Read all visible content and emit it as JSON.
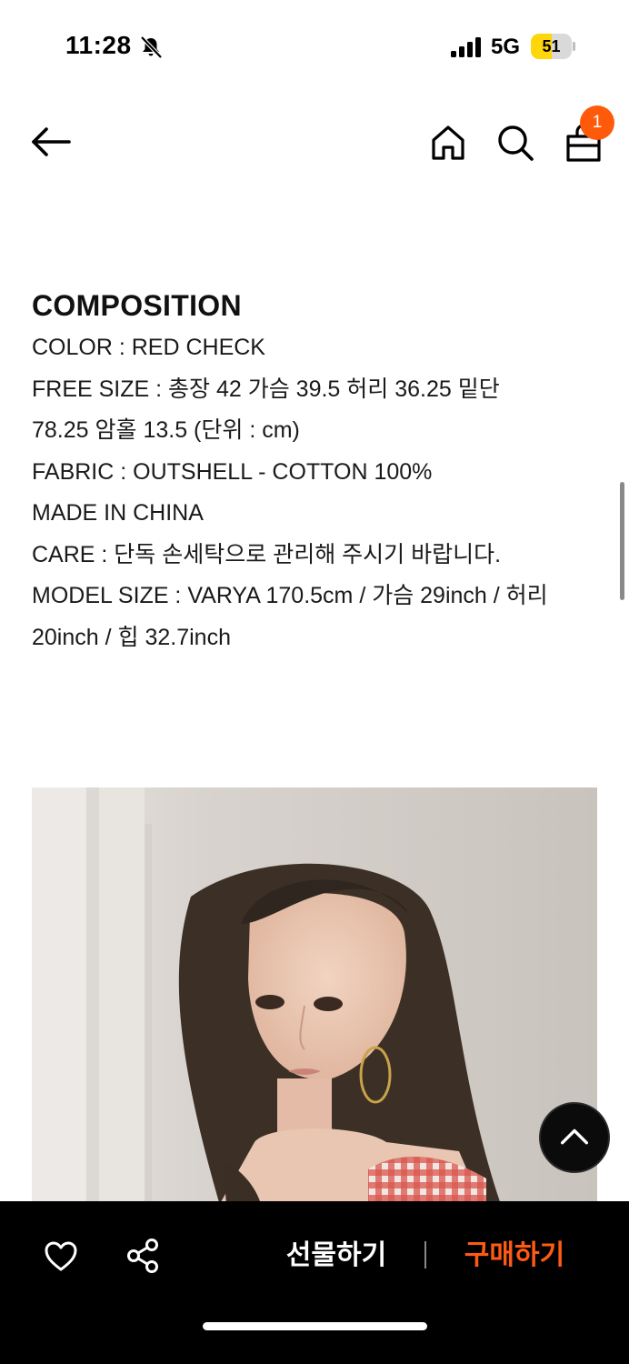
{
  "status_bar": {
    "time": "11:28",
    "network": "5G",
    "battery_level": "51",
    "battery_fraction": 0.51,
    "icons": [
      "bell-off-icon",
      "signal-icon",
      "battery-icon"
    ]
  },
  "nav": {
    "icons": [
      "arrow-left-icon",
      "home-icon",
      "search-icon",
      "shopping-bag-icon"
    ],
    "cart_count": "1"
  },
  "composition": {
    "title": "COMPOSITION",
    "lines": [
      "COLOR : RED CHECK",
      "FREE SIZE : 총장 42 가슴 39.5 허리 36.25 밑단",
      "78.25 암홀 13.5 (단위 : cm)",
      "FABRIC : OUTSHELL - COTTON 100%",
      "MADE IN CHINA",
      "CARE : 단독 손세탁으로 관리해 주시기 바랍니다.",
      "MODEL SIZE : VARYA 170.5cm / 가슴 29inch / 허리",
      "20inch / 힙 32.7inch"
    ]
  },
  "bottom_bar": {
    "gift_label": "선물하기",
    "buy_label": "구매하기",
    "icons": [
      "heart-icon",
      "share-icon",
      "chevron-up-icon"
    ]
  },
  "colors": {
    "accent": "#ff5a0a",
    "buy_text": "#ff5a14",
    "action_bar_bg": "#000000",
    "battery_fill": "#ffd60a"
  }
}
